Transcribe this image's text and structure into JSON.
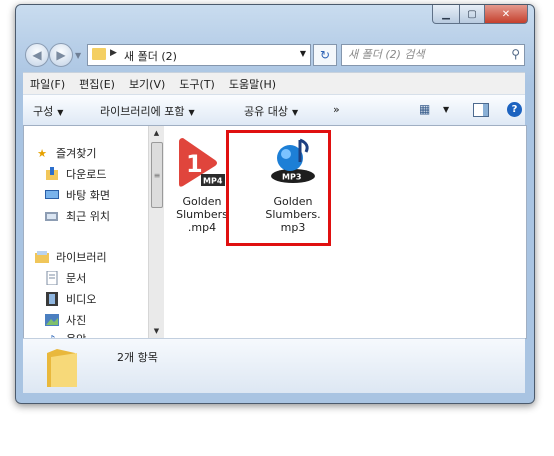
{
  "address": {
    "path": "새 폴더 (2)"
  },
  "search": {
    "placeholder": "새 폴더 (2) 검색"
  },
  "menu": [
    "파일(F)",
    "편집(E)",
    "보기(V)",
    "도구(T)",
    "도움말(H)"
  ],
  "toolbar": {
    "organize": "구성",
    "include_library": "라이브러리에 포함",
    "share": "공유 대상",
    "more": "»"
  },
  "nav": {
    "favorites": "즐겨찾기",
    "downloads": "다운로드",
    "desktop": "바탕 화면",
    "recent": "최근 위치",
    "libraries": "라이브러리",
    "documents": "문서",
    "videos": "비디오",
    "pictures": "사진",
    "music": "음악"
  },
  "files": [
    {
      "name": "Golden\nSlumbers\n.mp4",
      "icon": "mp4-file-icon",
      "badge": "MP4"
    },
    {
      "name": "Golden\nSlumbers.\nmp3",
      "icon": "mp3-file-icon",
      "badge": "MP3"
    }
  ],
  "status": {
    "count": "2개 항목"
  },
  "colors": {
    "highlight": "#e01010",
    "mp4_red": "#e0453c",
    "mp3_blue": "#1d7fd6"
  }
}
